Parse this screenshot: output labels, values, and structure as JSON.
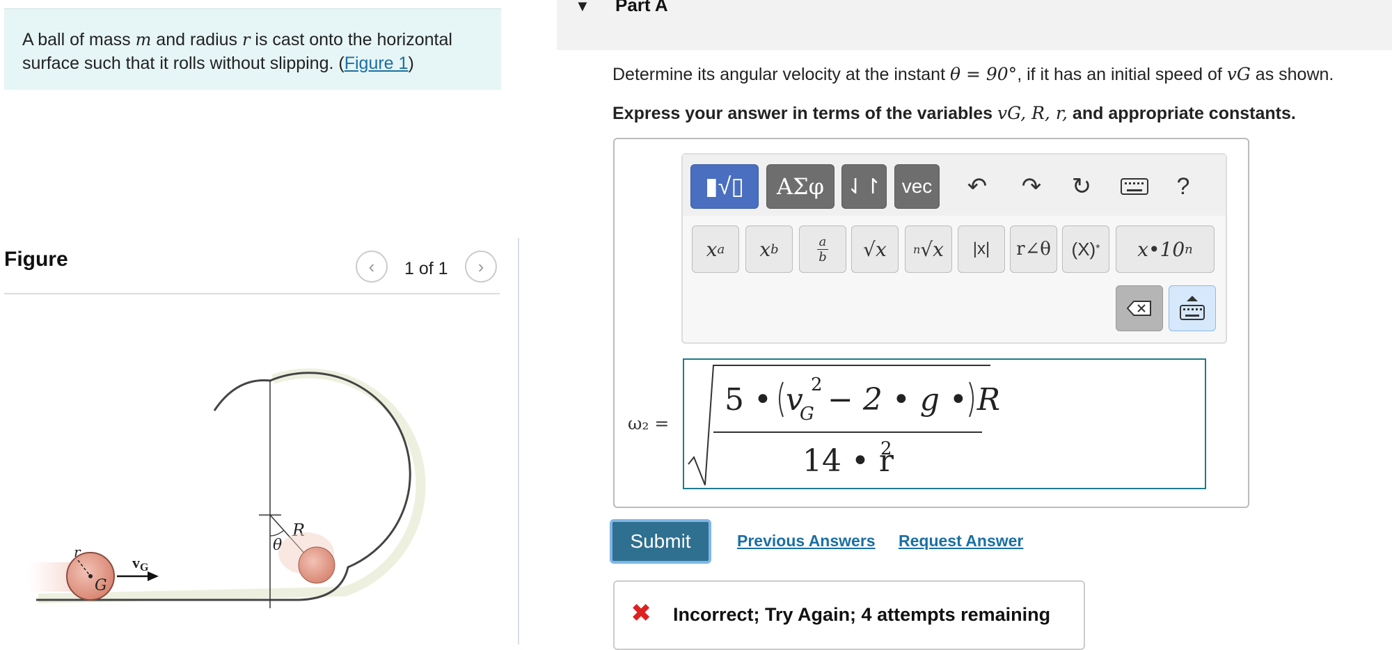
{
  "problem": {
    "prefix": "A ball of mass ",
    "mass_var": "m",
    "mid1": " and radius ",
    "radius_var": "r",
    "mid2": " is cast onto the horizontal surface such that it rolls without slipping. (",
    "figure_link": "Figure 1",
    "suffix": ")"
  },
  "figure": {
    "heading": "Figure",
    "counter": "1 of 1",
    "prev_icon": "chevron-left-icon",
    "next_icon": "chevron-right-icon",
    "labels": {
      "r": "r",
      "G": "G",
      "vG": "v",
      "vG_sub": "G",
      "theta": "θ",
      "R": "R"
    }
  },
  "part": {
    "title": "Part A",
    "caret_icon": "caret-down-icon"
  },
  "question": {
    "prefix": "Determine its angular velocity at the instant ",
    "theta": "θ = 90°",
    "mid": ", if it has an initial speed of ",
    "var": "vG",
    "suffix": " as shown."
  },
  "instruction": {
    "prefix": "Express your answer in terms of the variables ",
    "vars": "vG, R, r,",
    "suffix": " and appropriate constants."
  },
  "toolbar": {
    "templates_label": "▮√▯",
    "greek_label": "ΑΣφ",
    "arrows_label": "⇃↾",
    "vec_label": "vec",
    "undo_icon": "undo-icon",
    "redo_icon": "redo-icon",
    "reset_icon": "reset-icon",
    "keyboard_icon": "keyboard-icon",
    "help_label": "?",
    "row2": [
      "xᵃ",
      "x_b",
      "a/b",
      "√x",
      "ⁿ√x",
      "|x|",
      "r∠θ",
      "(X)*",
      "x•10ⁿ"
    ],
    "backspace_icon": "backspace-icon",
    "keyboard_toggle_icon": "keyboard-toggle-icon"
  },
  "answer": {
    "label": "ω₂ =",
    "numerator_coef": "5 •",
    "v": "v",
    "v_sub": "G",
    "v_sup": "2",
    "rest": "− 2 • g • R",
    "denominator": "14 • r",
    "denominator_sup": "2"
  },
  "actions": {
    "submit": "Submit",
    "previous_answers": "Previous Answers",
    "request_answer": "Request Answer"
  },
  "feedback": {
    "icon": "✖",
    "text": "Incorrect; Try Again; 4 attempts remaining"
  },
  "colors": {
    "problem_bg": "#e6f5f5",
    "link": "#1a6fa3",
    "submit_bg": "#2f6f8f",
    "error": "#d22222",
    "active_tool": "#4a6fc0"
  }
}
